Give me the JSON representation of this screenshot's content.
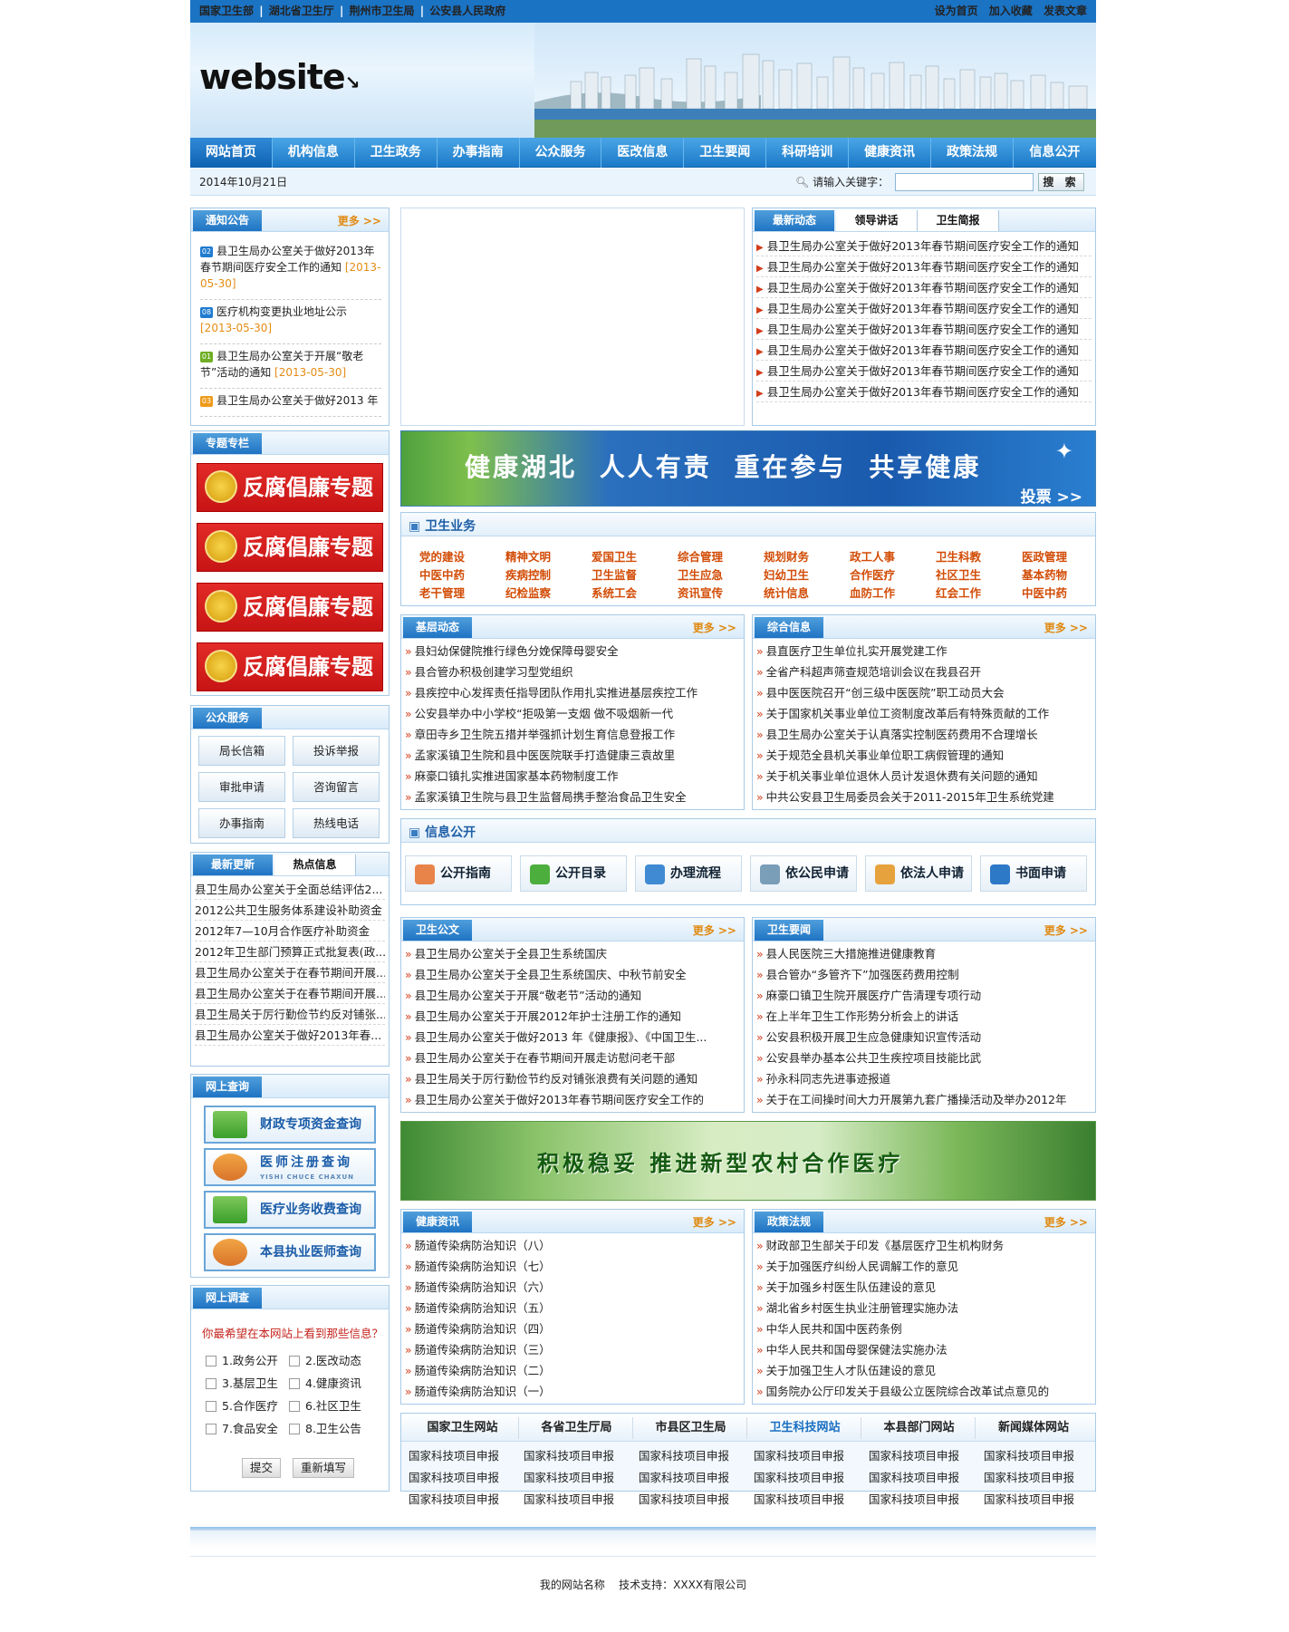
{
  "top": {
    "gov_links": [
      "国家卫生部",
      "湖北省卫生厅",
      "荆州市卫生局",
      "公安县人民政府"
    ],
    "right_links": [
      "设为首页",
      "加入收藏",
      "发表文章"
    ]
  },
  "logo": "website",
  "nav": [
    "网站首页",
    "机构信息",
    "卫生政务",
    "办事指南",
    "公众服务",
    "医改信息",
    "卫生要闻",
    "科研培训",
    "健康资讯",
    "政策法规",
    "信息公开"
  ],
  "search": {
    "date": "2014年10月21日",
    "label": "请输入关键字：",
    "placeholder": "",
    "button": "搜 索"
  },
  "notice": {
    "title": "通知公告",
    "more": "更多",
    "items": [
      {
        "num": "02",
        "text": "县卫生局办公室关于做好2013年春节期间医疗安全工作的通知",
        "date": "[2013-05-30]"
      },
      {
        "num": "08",
        "text": "医疗机构变更执业地址公示",
        "date": "[2013-05-30]"
      },
      {
        "num": "01",
        "text": "县卫生局办公室关于开展“敬老节”活动的通知",
        "date": "[2013-05-30]"
      },
      {
        "num": "03",
        "text": "县卫生局办公室关于做好2013 年",
        "date": ""
      }
    ]
  },
  "news": {
    "tabs": [
      "最新动态",
      "领导讲话",
      "卫生简报"
    ],
    "items": [
      "县卫生局办公室关于做好2013年春节期间医疗安全工作的通知",
      "县卫生局办公室关于做好2013年春节期间医疗安全工作的通知",
      "县卫生局办公室关于做好2013年春节期间医疗安全工作的通知",
      "县卫生局办公室关于做好2013年春节期间医疗安全工作的通知",
      "县卫生局办公室关于做好2013年春节期间医疗安全工作的通知",
      "县卫生局办公室关于做好2013年春节期间医疗安全工作的通知",
      "县卫生局办公室关于做好2013年春节期间医疗安全工作的通知",
      "县卫生局办公室关于做好2013年春节期间医疗安全工作的通知"
    ]
  },
  "special": {
    "title": "专题专栏",
    "banner_text": "反腐倡廉专题"
  },
  "health_banner": {
    "text": "健康湖北 人人有责 重在参与 共享健康",
    "vote": "投票 >>"
  },
  "business": {
    "title": "卫生业务",
    "items": [
      "党的建设",
      "精神文明",
      "爱国卫生",
      "综合管理",
      "规划财务",
      "政工人事",
      "卫生科教",
      "医政管理",
      "中医中药",
      "疾病控制",
      "卫生监督",
      "卫生应急",
      "妇幼卫生",
      "合作医疗",
      "社区卫生",
      "基本药物",
      "老干管理",
      "纪检监察",
      "系统工会",
      "资讯宣传",
      "统计信息",
      "血防工作",
      "红会工作",
      "中医中药"
    ]
  },
  "public_service": {
    "title": "公众服务",
    "items": [
      "局长信箱",
      "投诉举报",
      "审批申请",
      "咨询留言",
      "办事指南",
      "热线电话"
    ]
  },
  "grassroots": {
    "title": "基层动态",
    "more": "更多",
    "items": [
      "县妇幼保健院推行绿色分娩保障母婴安全",
      "县合管办积极创建学习型党组织",
      "县疾控中心发挥责任指导团队作用扎实推进基层疾控工作",
      "公安县举办中小学校“拒吸第一支烟 做不吸烟新一代",
      "章田寺乡卫生院五措并举强抓计划生育信息登报工作",
      "孟家溪镇卫生院和县中医医院联手打造健康三袁故里",
      "麻豪口镇扎实推进国家基本药物制度工作",
      "孟家溪镇卫生院与县卫生监督局携手整治食品卫生安全"
    ]
  },
  "general": {
    "title": "综合信息",
    "more": "更多",
    "items": [
      "县直医疗卫生单位扎实开展党建工作",
      "全省产科超声筛查规范培训会议在我县召开",
      "县中医医院召开“创三级中医医院”职工动员大会",
      "关于国家机关事业单位工资制度改革后有特殊贡献的工作",
      "县卫生局办公室关于认真落实控制医药费用不合理增长",
      "关于规范全县机关事业单位职工病假管理的通知",
      "关于机关事业单位退休人员计发退休费有关问题的通知",
      "中共公安县卫生局委员会关于2011-2015年卫生系统党建"
    ]
  },
  "latest": {
    "tabs": [
      "最新更新",
      "热点信息"
    ],
    "items": [
      "县卫生局办公室关于全面总结评估2...",
      "2012公共卫生服务体系建设补助资金",
      "2012年7—10月合作医疗补助资金",
      "2012年卫生部门预算正式批复表(政...",
      "县卫生局办公室关于在春节期间开展...",
      "县卫生局办公室关于在春节期间开展...",
      "县卫生局关于厉行勤俭节约反对铺张...",
      "县卫生局办公室关于做好2013年春..."
    ]
  },
  "info_open": {
    "title": "信息公开",
    "items": [
      "公开指南",
      "公开目录",
      "办理流程",
      "依公民申请",
      "依法人申请",
      "书面申请"
    ]
  },
  "query": {
    "title": "网上查询",
    "items": [
      "财政专项资金查询",
      "医师注册查询",
      "医疗业务收费查询",
      "本县执业医师查询"
    ],
    "subtitle": "YISHI CHUCE CHAXUN"
  },
  "affairs": {
    "title": "卫生公文",
    "more": "更多",
    "items": [
      "县卫生局办公室关于全县卫生系统国庆",
      "县卫生局办公室关于全县卫生系统国庆、中秋节前安全",
      "县卫生局办公室关于开展“敬老节”活动的通知",
      "县卫生局办公室关于开展2012年护士注册工作的通知",
      "县卫生局办公室关于做好2013 年《健康报》、《中国卫生...",
      "县卫生局办公室关于在春节期间开展走访慰问老干部",
      "县卫生局关于厉行勤俭节约反对铺张浪费有关问题的通知",
      "县卫生局办公室关于做好2013年春节期间医疗安全工作的"
    ]
  },
  "important": {
    "title": "卫生要闻",
    "more": "更多",
    "items": [
      "县人民医院三大措施推进健康教育",
      "县合管办“多管齐下”加强医药费用控制",
      "麻豪口镇卫生院开展医疗广告清理专项行动",
      "在上半年卫生工作形势分析会上的讲话",
      "公安县积极开展卫生应急健康知识宣传活动",
      "公安县举办基本公共卫生疾控项目技能比武",
      "孙永科同志先进事迹报道",
      "关于在工间操时间大力开展第九套广播操活动及举办2012年"
    ]
  },
  "rural_banner": {
    "text": "积极稳妥 推进新型农村合作医疗"
  },
  "survey": {
    "title": "网上调查",
    "question": "你最希望在本网站上看到那些信息？",
    "options": [
      "1.政务公开",
      "2.医改动态",
      "3.基层卫生",
      "4.健康资讯",
      "5.合作医疗",
      "6.社区卫生",
      "7.食品安全",
      "8.卫生公告"
    ],
    "submit": "提交",
    "reset": "重新填写"
  },
  "health_info": {
    "title": "健康资讯",
    "more": "更多",
    "items": [
      "肠道传染病防治知识（八）",
      "肠道传染病防治知识（七）",
      "肠道传染病防治知识（六）",
      "肠道传染病防治知识（五）",
      "肠道传染病防治知识（四）",
      "肠道传染病防治知识（三）",
      "肠道传染病防治知识（二）",
      "肠道传染病防治知识（一）"
    ]
  },
  "policy": {
    "title": "政策法规",
    "more": "更多",
    "items": [
      "财政部卫生部关于印发《基层医疗卫生机构财务",
      "关于加强医疗纠纷人民调解工作的意见",
      "关于加强乡村医生队伍建设的意见",
      "湖北省乡村医生执业注册管理实施办法",
      "中华人民共和国中医药条例",
      "中华人民共和国母婴保健法实施办法",
      "关于加强卫生人才队伍建设的意见",
      "国务院办公厅印发关于县级公立医院综合改革试点意见的"
    ]
  },
  "links": {
    "tabs": [
      "国家卫生网站",
      "各省卫生厅局",
      "市县区卫生局",
      "卫生科技网站",
      "本县部门网站",
      "新闻媒体网站"
    ],
    "cell": "国家科技项目申报"
  },
  "footer": {
    "text": "我的网站名称    技术支持：XXXX有限公司"
  },
  "colors": {
    "brand": "#1b73c4",
    "accent": "#e08a12",
    "alert": "#d23d1a"
  }
}
